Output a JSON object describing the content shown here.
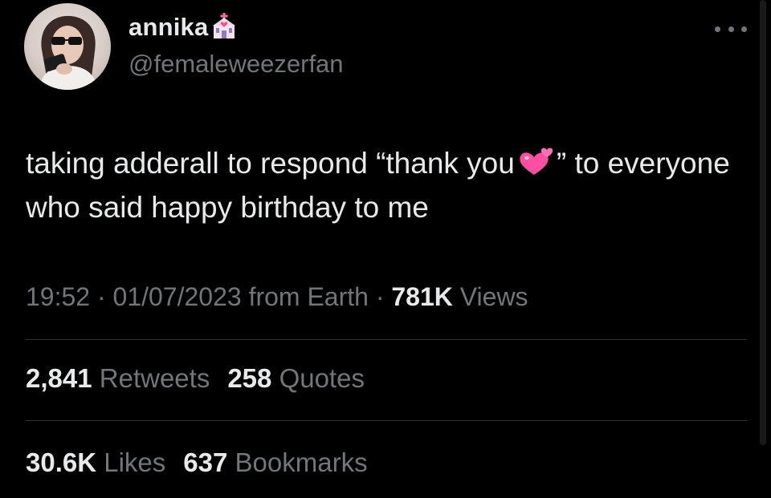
{
  "author": {
    "display_name": "annika",
    "handle": "@femaleweezerfan",
    "name_emoji": "wedding-chapel-icon",
    "avatar": "profile-photo"
  },
  "menu": {
    "icon": "more-horizontal-icon"
  },
  "tweet": {
    "text_part1": "taking adderall to respond “thank you",
    "emoji": "two-hearts-icon",
    "text_part2": "” to everyone who said happy birthday to me"
  },
  "meta": {
    "time": "19:52",
    "sep1": " · ",
    "date": "01/07/2023",
    "source": " from Earth",
    "sep2": " · ",
    "views_count": "781K",
    "views_label": " Views"
  },
  "stats": {
    "retweets_count": "2,841",
    "retweets_label": "Retweets",
    "quotes_count": "258",
    "quotes_label": "Quotes",
    "likes_count": "30.6K",
    "likes_label": "Likes",
    "bookmarks_count": "637",
    "bookmarks_label": "Bookmarks"
  },
  "colors": {
    "background": "#000000",
    "primary_text": "#e7e9ea",
    "secondary_text": "#71767b",
    "divider": "#2f3336",
    "heart_pink": "#ff4fa3"
  }
}
